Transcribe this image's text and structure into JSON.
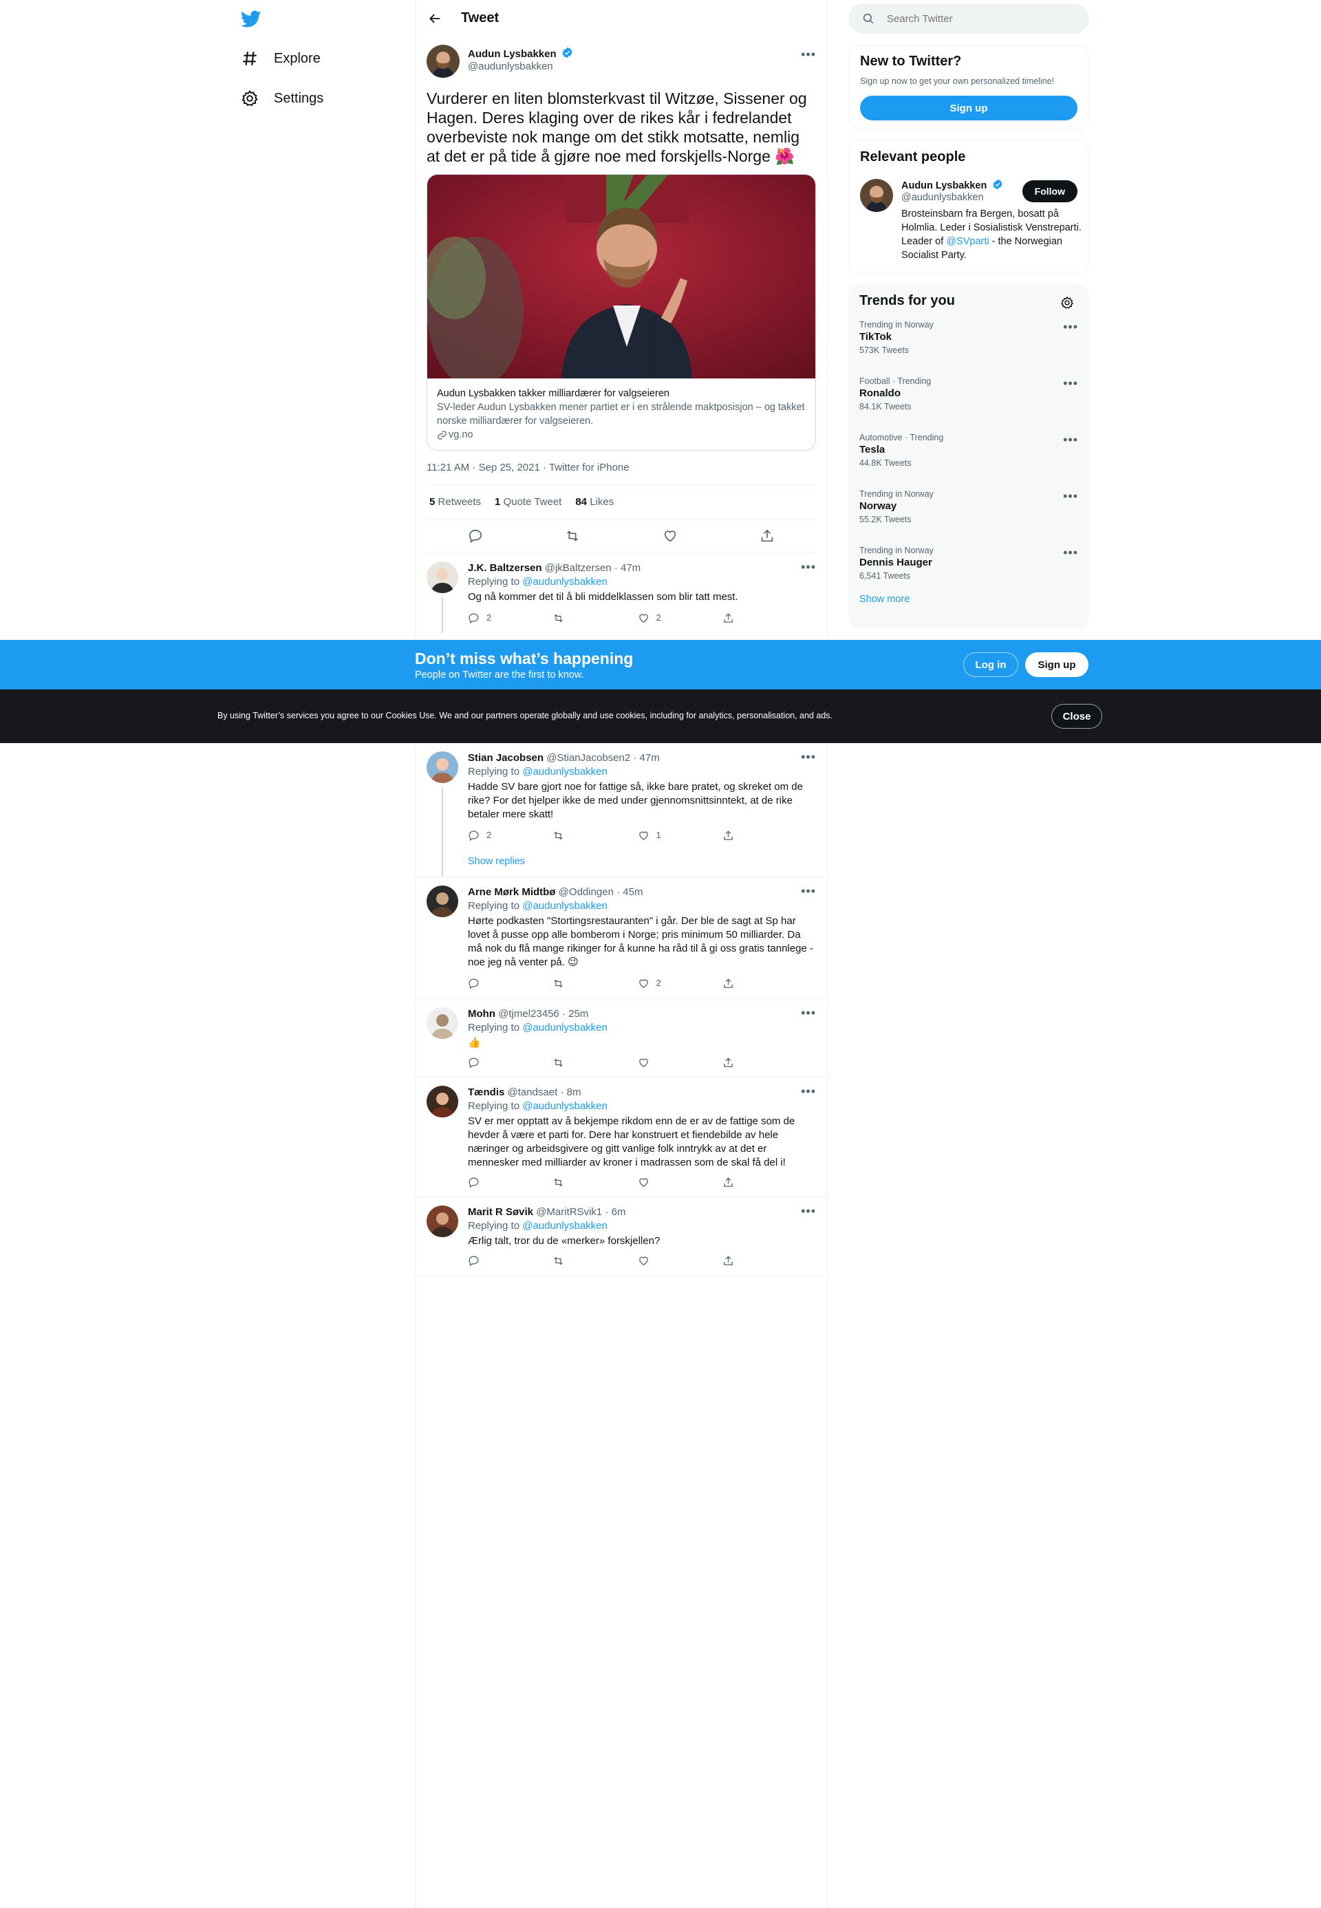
{
  "nav": {
    "items": [
      {
        "label": "Explore",
        "icon": "hashtag-icon"
      },
      {
        "label": "Settings",
        "icon": "gear-icon"
      }
    ]
  },
  "main": {
    "header_title": "Tweet",
    "tweet": {
      "author_name": "Audun Lysbakken",
      "author_handle": "@audunlysbakken",
      "text": "Vurderer en liten blomsterkvast til Witzøe, Sissener og Hagen. Deres klaging over de rikes kår i fedrelandet overbeviste nok mange om det stikk motsatte, nemlig at det er på tide å gjøre noe med forskjells-Norge 🌺",
      "card_title": "Audun Lysbakken takker milliardærer for valgseieren",
      "card_desc": "SV-leder Audun Lysbakken mener partiet er i en strålende maktposisjon – og takket norske milliardærer for valgseieren.",
      "card_domain": "vg.no",
      "timestamp": "11:21 AM · Sep 25, 2021 · Twitter for iPhone",
      "retweets_count": "5",
      "retweets_label": "Retweets",
      "quotes_count": "1",
      "quotes_label": "Quote Tweet",
      "likes_count": "84",
      "likes_label": "Likes"
    },
    "replying_to_label": "Replying to",
    "replying_to_handle": "@audunlysbakken",
    "show_replies": "Show replies",
    "replies": [
      {
        "name": "J.K. Baltzersen",
        "handle": "@jkBaltzersen",
        "time": "47m",
        "text": "Og nå kommer det til å bli middelklassen som blir tatt mest.",
        "replies": "2",
        "retweets": "",
        "likes": "2"
      },
      {
        "name": "Stian Jacobsen",
        "handle": "@StianJacobsen2",
        "time": "47m",
        "text": "Hadde SV bare gjort noe for fattige så, ikke bare pratet, og skreket om de rike? For det hjelper ikke de med under gjennomsnittsinntekt, at de rike betaler mere skatt!",
        "replies": "2",
        "retweets": "",
        "likes": "1"
      },
      {
        "name": "Arne Mørk Midtbø",
        "handle": "@Oddingen",
        "time": "45m",
        "text": "Hørte podkasten \"Stortingsrestauranten\" i går. Der ble de sagt at Sp har lovet å pusse opp alle bomberom i Norge; pris minimum 50 milliarder. Da må nok du flå mange rikinger for å kunne ha råd til å gi oss gratis tannlege - noe jeg nå venter på. 😉",
        "replies": "",
        "retweets": "",
        "likes": "2"
      },
      {
        "name": "Mohn",
        "handle": "@tjmel23456",
        "time": "25m",
        "text": "👍",
        "replies": "",
        "retweets": "",
        "likes": ""
      },
      {
        "name": "Tændis",
        "handle": "@tandsaet",
        "time": "8m",
        "text": "SV er mer opptatt av å bekjempe rikdom enn de er av de fattige som de hevder å være et parti for. Dere har konstruert et fiendebilde av hele næringer og arbeidsgivere og gitt vanlige folk inntrykk av at det er mennesker med milliarder av kroner i madrassen som de skal få del i!",
        "replies": "",
        "retweets": "",
        "likes": ""
      },
      {
        "name": "Marit R Søvik",
        "handle": "@MaritRSvik1",
        "time": "6m",
        "text": "Ærlig talt, tror du de «merker» forskjellen?",
        "replies": "",
        "retweets": "",
        "likes": ""
      }
    ]
  },
  "right": {
    "search_placeholder": "Search Twitter",
    "new_title": "New to Twitter?",
    "new_sub": "Sign up now to get your own personalized timeline!",
    "signup_label": "Sign up",
    "relevant_title": "Relevant people",
    "person_name": "Audun Lysbakken",
    "person_handle": "@audunlysbakken",
    "follow_label": "Follow",
    "bio_pre": "Brosteinsbarn fra Bergen, bosatt på Holmlia. Leder i Sosialistisk Venstreparti. Leader of ",
    "bio_link": "@SVparti",
    "bio_post": " - the Norwegian Socialist Party.",
    "trends_title": "Trends for you",
    "trends": [
      {
        "cat": "Trending in Norway",
        "name": "TikTok",
        "count": "573K Tweets"
      },
      {
        "cat": "Football · Trending",
        "name": "Ronaldo",
        "count": "84.1K Tweets"
      },
      {
        "cat": "Automotive · Trending",
        "name": "Tesla",
        "count": "44.8K Tweets"
      },
      {
        "cat": "Trending in Norway",
        "name": "Norway",
        "count": "55.2K Tweets"
      },
      {
        "cat": "Trending in Norway",
        "name": "Dennis Hauger",
        "count": "6,541 Tweets"
      }
    ],
    "show_more": "Show more"
  },
  "bottom_bar": {
    "title": "Don’t miss what’s happening",
    "sub": "People on Twitter are the first to know.",
    "login_label": "Log in",
    "signup_label": "Sign up"
  },
  "cookie": {
    "text": "By using Twitter’s services you agree to our Cookies Use. We and our partners operate globally and use cookies, including for analytics, personalisation, and ads.",
    "close_label": "Close"
  },
  "colors": {
    "accent": "#1d9bf0",
    "dark": "#0f1419",
    "muted": "#536471",
    "cookie_bg": "#16181c"
  }
}
